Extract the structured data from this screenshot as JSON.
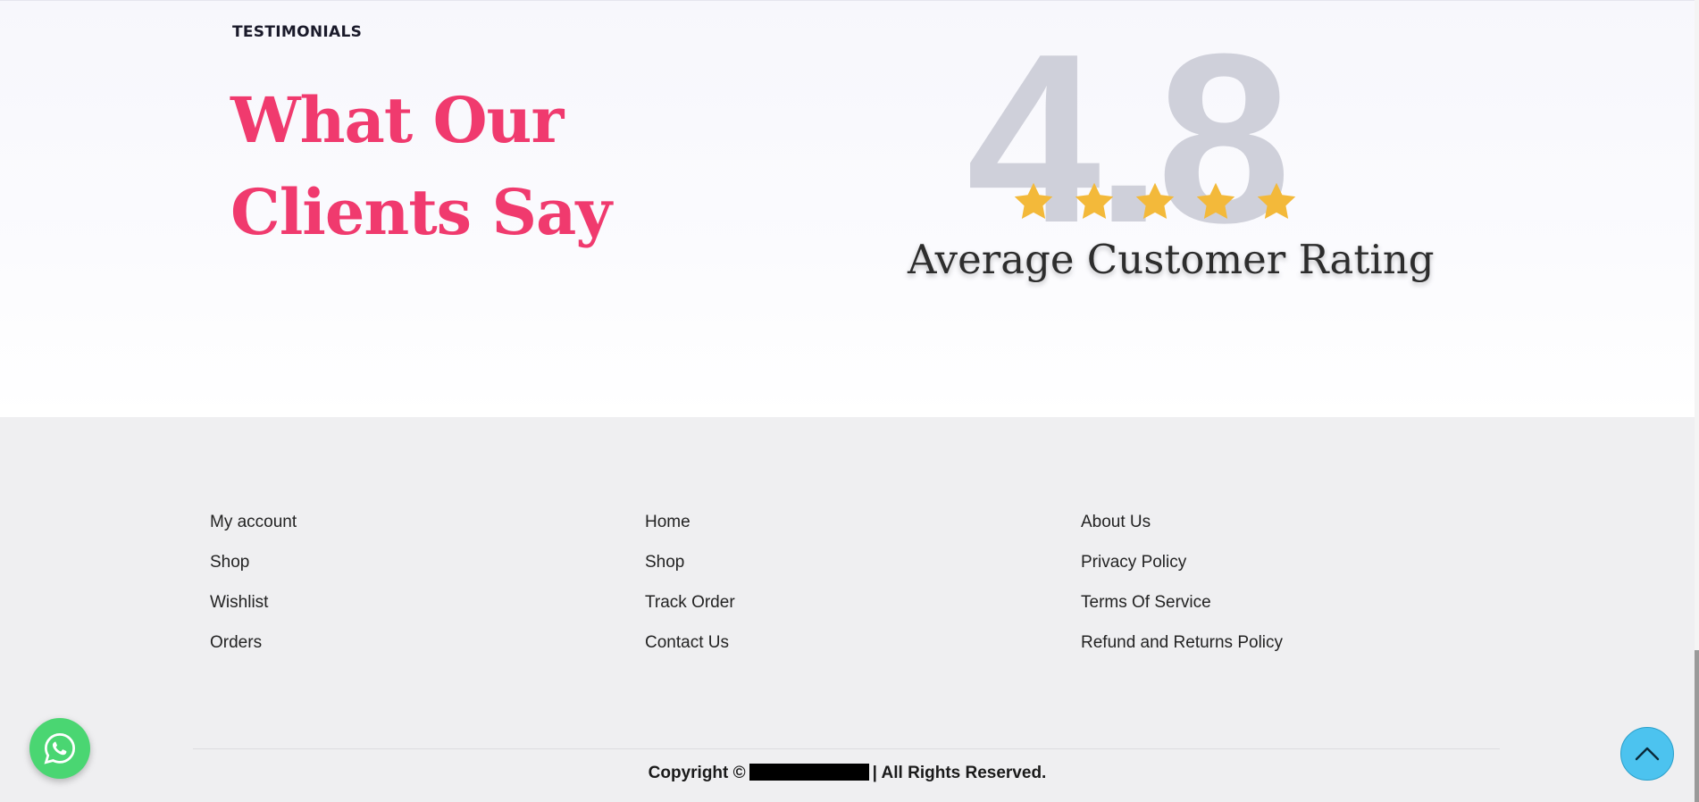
{
  "testimonials": {
    "kicker": "TESTIMONIALS",
    "heading": "What Our Clients Say",
    "rating_value": "4.8",
    "rating_stars": 5,
    "rating_caption": "Average Customer Rating",
    "colors": {
      "heading": "#f03a6e",
      "rating_number": "#cfd0da",
      "star": "#f3b93a"
    }
  },
  "footer": {
    "column1": [
      "My account",
      "Shop",
      "Wishlist",
      "Orders"
    ],
    "column2": [
      "Home",
      "Shop",
      "Track Order",
      "Contact Us"
    ],
    "column3": [
      "About Us",
      "Privacy Policy",
      "Terms Of Service",
      "Refund and Returns Policy"
    ],
    "copyright_prefix": "Copyright ©",
    "copyright_suffix": "|  All Rights Reserved."
  },
  "floating": {
    "whatsapp_icon": "whatsapp-icon",
    "totop_icon": "chevron-up-icon",
    "colors": {
      "whatsapp": "#4ad672",
      "totop": "#4cc3ef"
    }
  }
}
